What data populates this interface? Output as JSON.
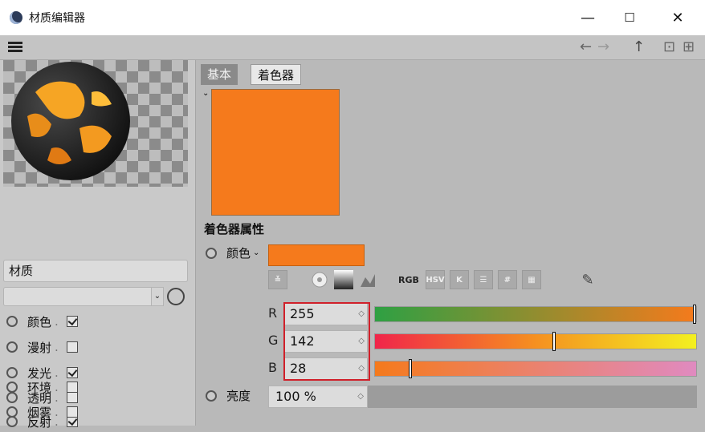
{
  "window": {
    "title": "材质编辑器",
    "minimize": "—",
    "maximize": "☐",
    "close": "✕"
  },
  "toolbar": {
    "back": "←",
    "forward": "→",
    "up": "↑",
    "lock": "⊡",
    "add": "⊞"
  },
  "left": {
    "material_name": "材质",
    "channels": [
      {
        "label": "颜色",
        "checked": true
      },
      {
        "label": "漫射",
        "checked": false
      },
      {
        "label": "发光",
        "checked": true
      },
      {
        "label": "透明",
        "checked": false
      },
      {
        "label": "反射",
        "checked": true
      },
      {
        "label": "环境",
        "checked": false
      },
      {
        "label": "烟雾",
        "checked": false
      }
    ]
  },
  "tabs": {
    "base": "基本",
    "shader": "着色器"
  },
  "shader": {
    "section_title": "着色器属性",
    "color_label": "颜色",
    "color_hex": "#F57A1C",
    "modes": {
      "rgb": "RGB",
      "hsv": "HSV",
      "k": "K",
      "hex": "#"
    },
    "R": {
      "label": "R",
      "value": "255",
      "fraction": 1.0
    },
    "G": {
      "label": "G",
      "value": "142",
      "fraction": 0.557
    },
    "B": {
      "label": "B",
      "value": "28",
      "fraction": 0.11
    },
    "brightness_label": "亮度",
    "brightness_value": "100 %"
  }
}
